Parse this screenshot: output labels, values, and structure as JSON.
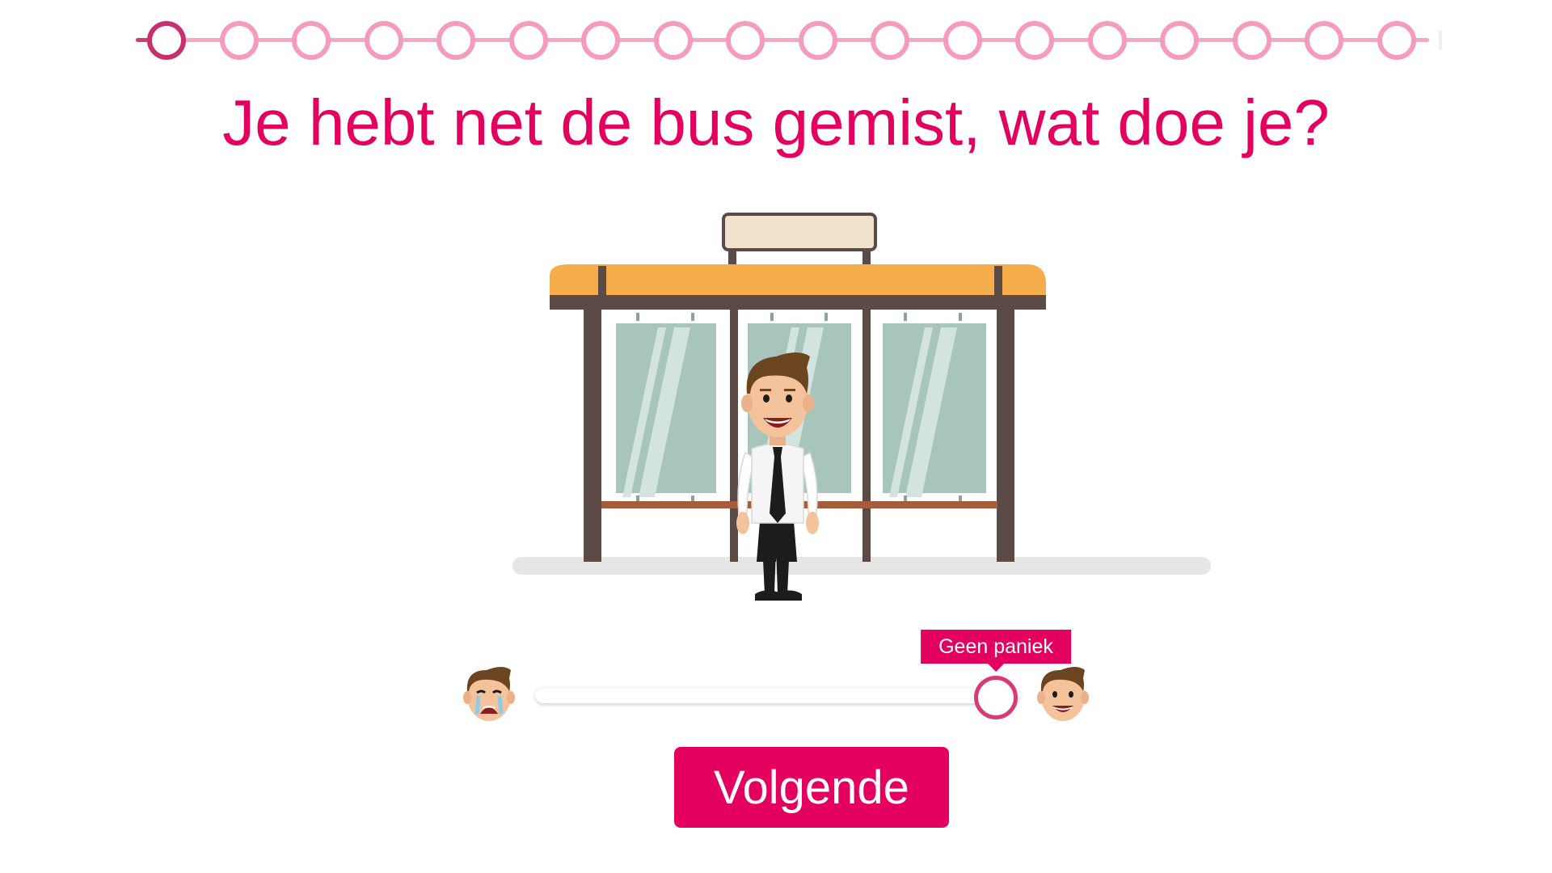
{
  "progress": {
    "total_steps": 18,
    "current_step": 1
  },
  "question": {
    "text": "Je hebt net de bus gemist, wat doe je?"
  },
  "illustration": {
    "icon": "bus-stop-man-illustration"
  },
  "slider": {
    "value": 0.95,
    "tooltip_label": "Geen paniek",
    "left_icon": "crying-face-icon",
    "right_icon": "smiling-face-icon"
  },
  "next_button": {
    "label": "Volgende"
  },
  "colors": {
    "accent": "#e4005f",
    "step_ring": "#f59bbd",
    "step_current": "#c8306d",
    "roof": "#f4ad4a",
    "frame": "#5c4a47",
    "glass": "#a8c5bc"
  }
}
